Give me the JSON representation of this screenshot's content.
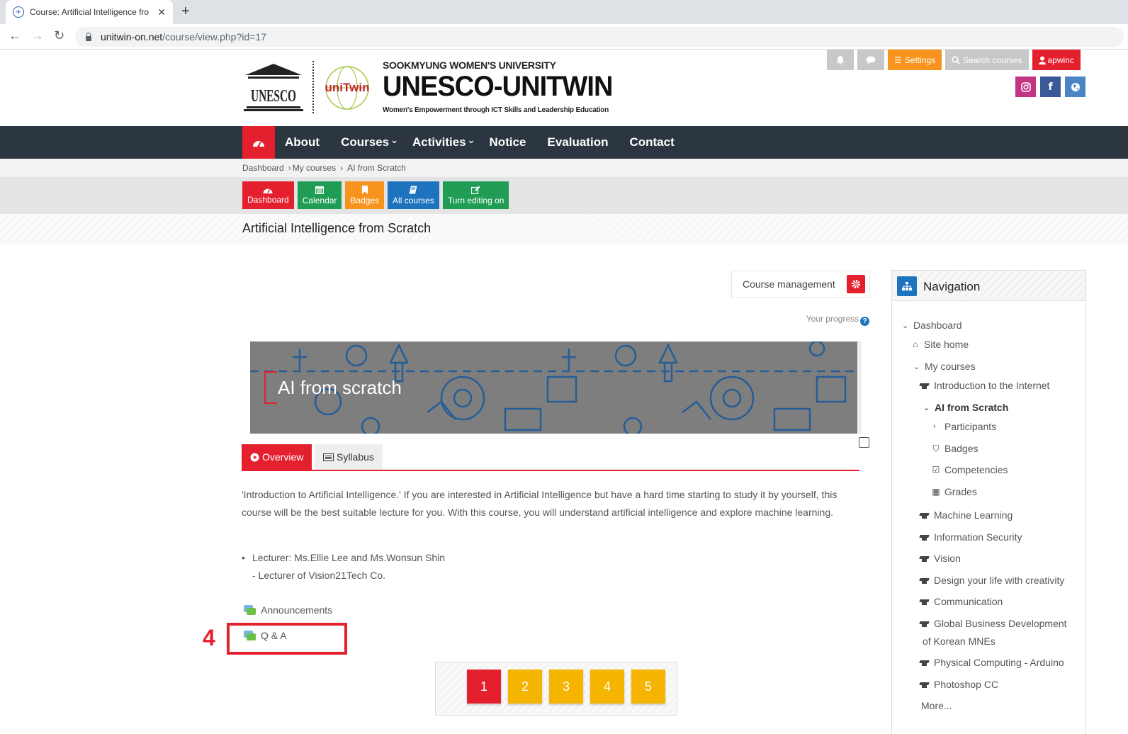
{
  "browser": {
    "tab_title": "Course: Artificial Intelligence fro",
    "tab_close": "✕",
    "new_tab": "+",
    "url_host": "unitwin-on.net",
    "url_path": "/course/view.php?id=17"
  },
  "header": {
    "brand_sub": "SOOKMYUNG WOMEN'S UNIVERSITY",
    "brand_main": "UNESCO-UNITWIN",
    "brand_tag": "Women's Empowerment through ICT Skills and Leadership Education",
    "unesco_text": "UNESCO",
    "unitwin_text": "uniTwin",
    "settings_label": "Settings",
    "search_label": "Search courses",
    "user_label": "apwinc",
    "colors": {
      "red": "#e5202e",
      "orange": "#f7941d",
      "grey": "#c8c8c8"
    }
  },
  "mainnav": {
    "items": [
      {
        "label": "About"
      },
      {
        "label": "Courses"
      },
      {
        "label": "Activities"
      },
      {
        "label": "Notice"
      },
      {
        "label": "Evaluation"
      },
      {
        "label": "Contact"
      }
    ]
  },
  "breadcrumb": {
    "items": [
      "Dashboard",
      "My courses",
      "AI from Scratch"
    ],
    "separator": "›"
  },
  "quick_buttons": [
    {
      "label": "Dashboard",
      "icon": "dashboard-icon",
      "color": "#e5202e"
    },
    {
      "label": "Calendar",
      "icon": "calendar-icon",
      "color": "#1f9d55"
    },
    {
      "label": "Badges",
      "icon": "bookmark-icon",
      "color": "#f7941d"
    },
    {
      "label": "All courses",
      "icon": "book-icon",
      "color": "#1e73be"
    },
    {
      "label": "Turn editing on",
      "icon": "edit-icon",
      "color": "#1f9d55"
    }
  ],
  "course": {
    "title": "Artificial Intelligence from Scratch",
    "management_label": "Course management",
    "progress_label": "Your progress",
    "banner_title": "AI from scratch",
    "tabs": [
      {
        "label": "Overview",
        "active": true
      },
      {
        "label": "Syllabus",
        "active": false
      }
    ],
    "description": "'Introduction to Artificial Intelligence.' If you are interested in Artificial Intelligence but have a hard time starting to study it by yourself, this course will be the best suitable lecture for you. With this course, you will understand artificial intelligence and explore machine learning.",
    "lecturer_line1": "Lecturer: Ms.Ellie Lee and Ms.Wonsun Shin",
    "lecturer_line2": "- Lecturer of Vision21Tech Co.",
    "activities": [
      {
        "label": "Announcements"
      },
      {
        "label": "Q & A"
      }
    ],
    "marker_number": "4",
    "pages": [
      "1",
      "2",
      "3",
      "4",
      "5"
    ],
    "current_page": "1"
  },
  "navigation": {
    "title": "Navigation",
    "dashboard": "Dashboard",
    "site_home": "Site home",
    "my_courses": "My courses",
    "courses_before": [
      "Introduction to the Internet"
    ],
    "current_course": "AI from Scratch",
    "current_children": [
      "Participants",
      "Badges",
      "Competencies",
      "Grades"
    ],
    "courses_after": [
      "Machine Learning",
      "Information Security",
      "Vision",
      "Design your life with creativity",
      "Communication",
      "Global Business Development",
      "Physical Computing - Arduino",
      "Photoshop CC"
    ],
    "global_business_line2": "of Korean MNEs",
    "more": "More..."
  }
}
